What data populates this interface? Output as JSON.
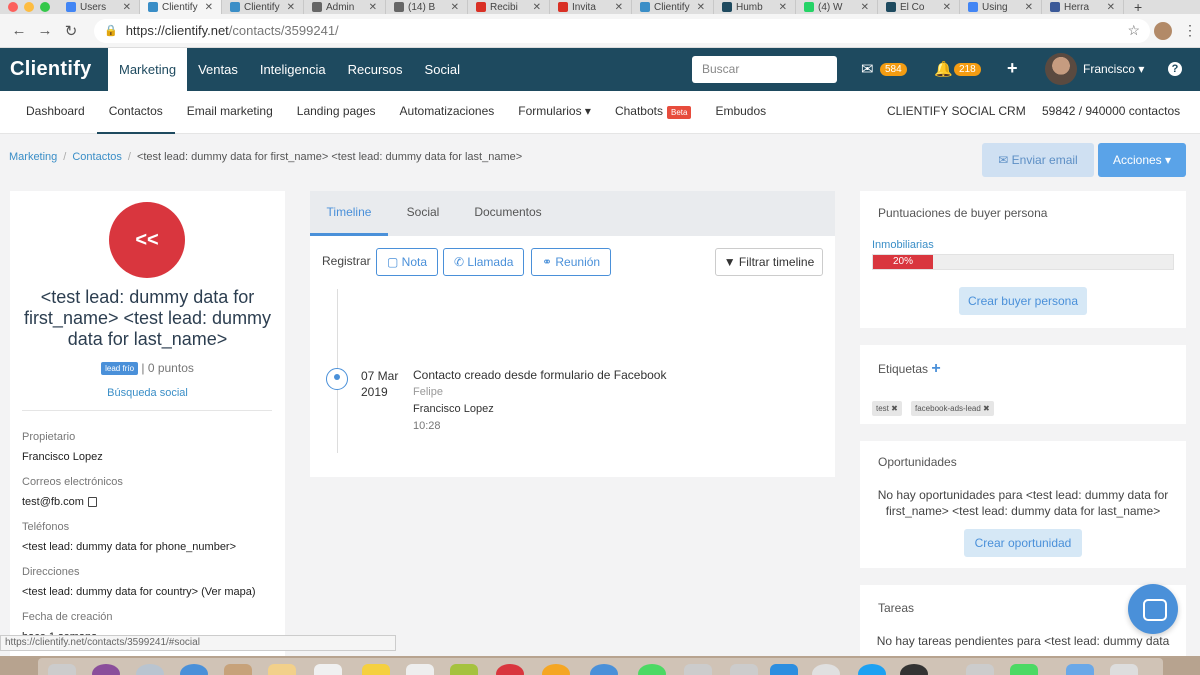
{
  "browser": {
    "tabs": [
      {
        "label": "Users",
        "color": "#4285f4"
      },
      {
        "label": "Clientify",
        "color": "#3a8ec7",
        "active": true
      },
      {
        "label": "Clientify",
        "color": "#3a8ec7"
      },
      {
        "label": "Admin",
        "color": "#666666"
      },
      {
        "label": "(14) B",
        "color": "#666666"
      },
      {
        "label": "Recibi",
        "color": "#d93025"
      },
      {
        "label": "Invita",
        "color": "#d93025"
      },
      {
        "label": "Clientify",
        "color": "#3a8ec7"
      },
      {
        "label": "Humb",
        "color": "#1e4a5f"
      },
      {
        "label": "(4) W",
        "color": "#25d366"
      },
      {
        "label": "El Co",
        "color": "#1e4a5f"
      },
      {
        "label": "Using",
        "color": "#4285f4"
      },
      {
        "label": "Herra",
        "color": "#3b5998"
      }
    ],
    "url_domain": "https://clientify.net",
    "url_path": "/contacts/3599241/",
    "status_url": "https://clientify.net/contacts/3599241/#social"
  },
  "topnav": {
    "logo": "Clientify",
    "items": [
      "Marketing",
      "Ventas",
      "Inteligencia",
      "Recursos",
      "Social"
    ],
    "search_placeholder": "Buscar",
    "mail_count": "584",
    "notif_count": "218",
    "user_name": "Francisco ▾",
    "help": "?"
  },
  "subnav": {
    "items": [
      "Dashboard",
      "Contactos",
      "Email marketing",
      "Landing pages",
      "Automatizaciones",
      "Formularios ▾",
      "Chatbots",
      "Embudos"
    ],
    "beta_label": "Beta",
    "crm_label": "CLIENTIFY SOCIAL CRM",
    "contacts_count": "59842 / 940000 contactos"
  },
  "breadcrumb": {
    "marketing": "Marketing",
    "contactos": "Contactos",
    "current": "<test lead: dummy data for first_name> <test lead: dummy data for last_name>"
  },
  "actions": {
    "send_email": "Enviar email",
    "actions": "Acciones ▾"
  },
  "contact": {
    "initials": "<<",
    "name": "<test lead: dummy data for first_name> <test lead: dummy data for last_name>",
    "tag": "lead frío",
    "points": "| 0 puntos",
    "social_search": "Búsqueda social",
    "fields": [
      {
        "label": "Propietario",
        "value": "Francisco Lopez"
      },
      {
        "label": "Correos electrónicos",
        "value": "test@fb.com"
      },
      {
        "label": "Teléfonos",
        "value": "<test lead: dummy data for phone_number>"
      },
      {
        "label": "Direcciones",
        "value": "<test lead: dummy data for country> (Ver mapa)"
      },
      {
        "label": "Fecha de creación",
        "value": "hace 1 semana"
      }
    ]
  },
  "timeline": {
    "tabs": [
      "Timeline",
      "Social",
      "Documentos"
    ],
    "register_label": "Registrar",
    "buttons": [
      "Nota",
      "Llamada",
      "Reunión"
    ],
    "filter": "Filtrar timeline",
    "event": {
      "date": "07 Mar 2019",
      "title": "Contacto creado desde formulario de Facebook",
      "sub1": "Felipe",
      "sub2": "Francisco Lopez",
      "time": "10:28"
    }
  },
  "buyer_persona": {
    "title": "Puntuaciones de buyer persona",
    "persona_name": "Inmobiliarias",
    "score_label": "20%",
    "score": 0.2,
    "create_button": "Crear buyer persona"
  },
  "tags": {
    "title": "Etiquetas",
    "add": "+",
    "items": [
      "test ✖",
      "facebook-ads-lead ✖"
    ]
  },
  "opportunities": {
    "title": "Oportunidades",
    "empty": "No hay oportunidades para <test lead: dummy data for first_name> <test lead: dummy data for last_name>",
    "create_button": "Crear oportunidad"
  },
  "tasks": {
    "title": "Tareas",
    "empty": "No hay tareas pendientes para <test lead: dummy data"
  },
  "colors": {
    "brand": "#1e4a5f",
    "accent": "#4a90d9",
    "lead": "#d9363e",
    "badge": "#f39c12"
  }
}
